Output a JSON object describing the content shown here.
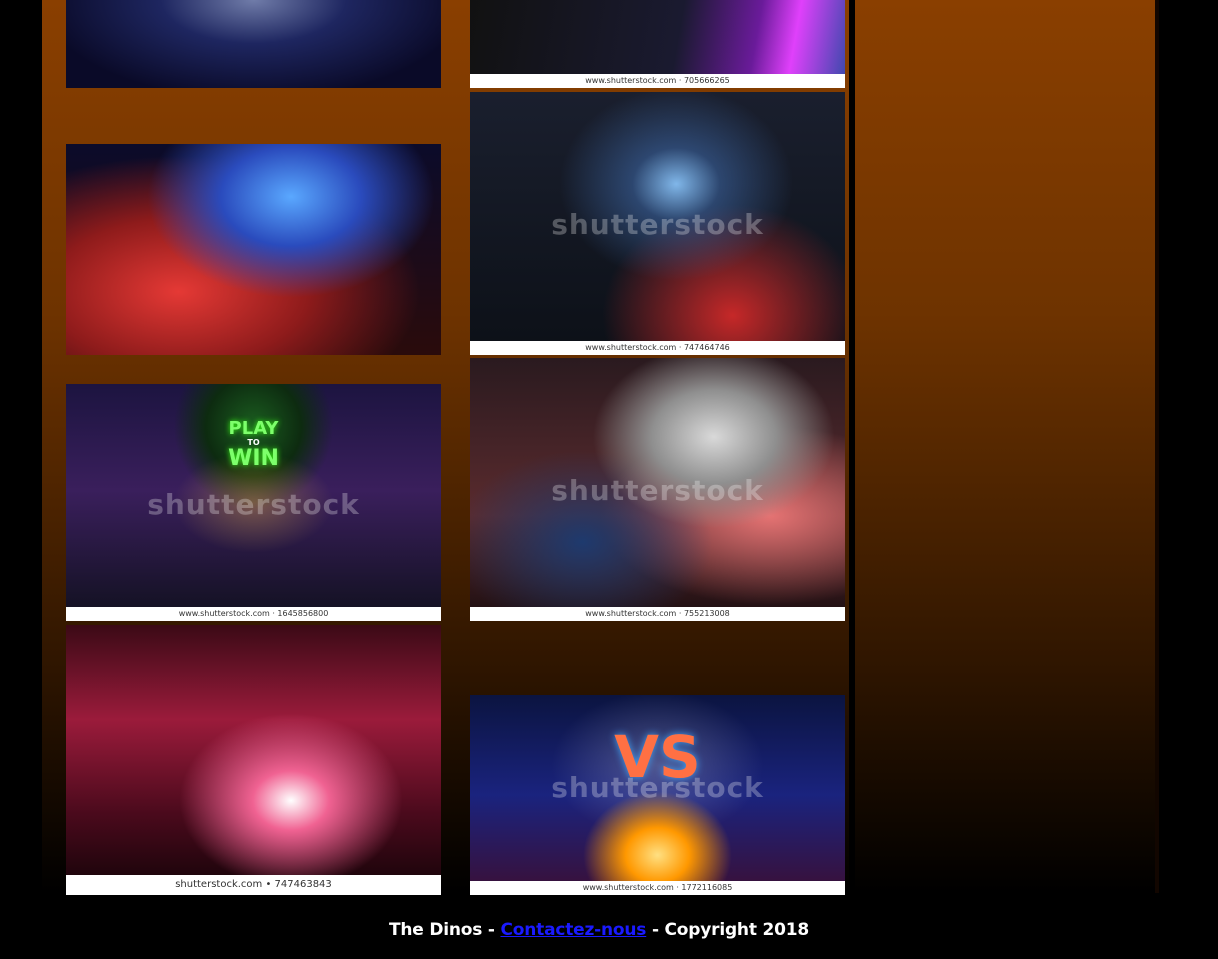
{
  "gallery": {
    "photos": [
      {
        "id": "arena-crowd-top",
        "caption": ""
      },
      {
        "id": "gamer-keyboard",
        "caption": "www.shutterstock.com · 705666265"
      },
      {
        "id": "arena-red-blue",
        "caption": ""
      },
      {
        "id": "arena-stage-screen",
        "caption": "www.shutterstock.com · 747464746"
      },
      {
        "id": "play-to-win",
        "caption": "www.shutterstock.com · 1645856800",
        "overlay_line1": "PLAY",
        "overlay_line2": "TO",
        "overlay_line3": "WIN"
      },
      {
        "id": "trophy-lift",
        "caption": "www.shutterstock.com · 755213008"
      },
      {
        "id": "red-arena",
        "caption": "shutterstock.com • 747463843"
      },
      {
        "id": "vs-trophy",
        "caption": "www.shutterstock.com · 1772116085",
        "overlay_text": "VS"
      }
    ],
    "watermark": "shutterstock"
  },
  "footer": {
    "prefix": "The Dinos - ",
    "link_label": "Contactez-nous",
    "suffix": " - Copyright 2018"
  },
  "colors": {
    "panel_top": "#8a3f00",
    "link": "#1a1aff",
    "footer_text": "#ffffff"
  }
}
